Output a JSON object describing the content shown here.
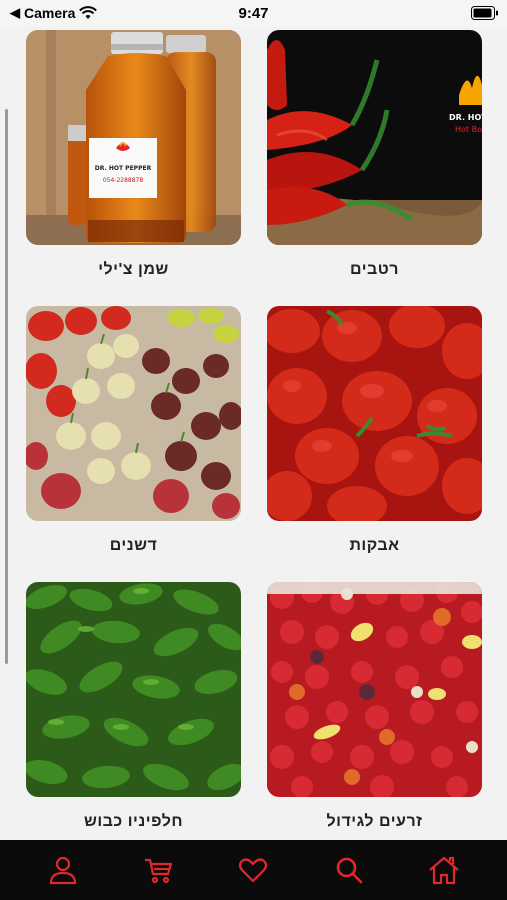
{
  "status_bar": {
    "back_app": "Camera",
    "time": "9:47"
  },
  "categories": [
    {
      "label": "שמן צ'ילי",
      "image": "chili-oil-bottles"
    },
    {
      "label": "רטבים",
      "image": "red-chili-peppers-dark"
    },
    {
      "label": "דשנים",
      "image": "mixed-superhot-peppers"
    },
    {
      "label": "אבקות",
      "image": "red-reaper-peppers"
    },
    {
      "label": "חלפיניו כבוש",
      "image": "green-jalapenos"
    },
    {
      "label": "זרעים לגידול",
      "image": "mixed-chili-harvest"
    }
  ],
  "bottle_label": {
    "brand": "DR. HOT PEPPER",
    "phone": "054-2288878"
  },
  "sauce_logo": {
    "brand": "DR. HOT",
    "sub": "Hot Bo"
  },
  "tabbar": {
    "accent": "#e0282e",
    "background": "#0b0b0b",
    "items": [
      "profile-icon",
      "cart-icon",
      "heart-icon",
      "search-icon",
      "home-icon"
    ]
  }
}
